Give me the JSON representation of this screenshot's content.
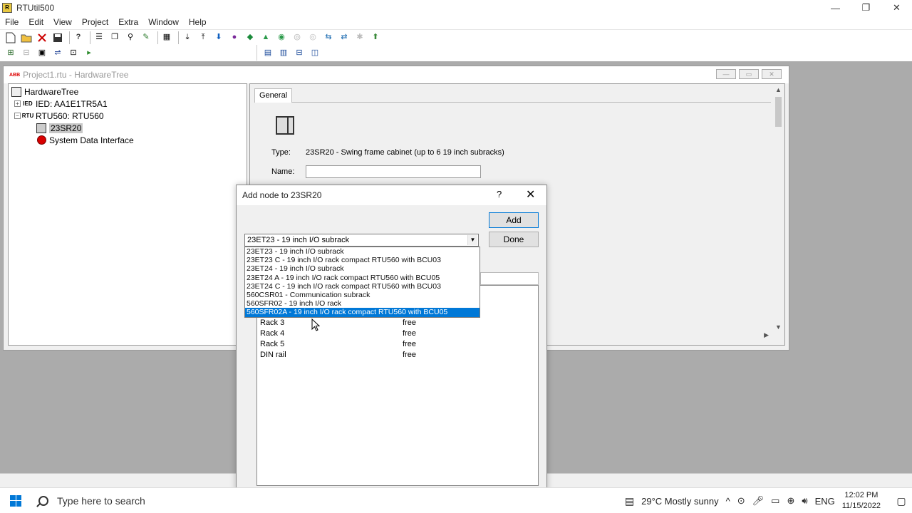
{
  "app": {
    "title": "RTUtil500",
    "icon": "app-icon",
    "controls": [
      "—",
      "❐",
      "✕"
    ]
  },
  "menu": [
    "File",
    "Edit",
    "View",
    "Project",
    "Extra",
    "Window",
    "Help"
  ],
  "child_window": {
    "title": "Project1.rtu - HardwareTree",
    "brand": "ABB"
  },
  "tree": {
    "root": "HardwareTree",
    "items": [
      {
        "label": "IED: AA1E1TR5A1",
        "icon_text": "IED",
        "level": 1
      },
      {
        "label": "RTU560: RTU560",
        "icon_text": "RTU",
        "level": 1
      },
      {
        "label": "23SR20",
        "level": 2,
        "selected": true
      },
      {
        "label": "System Data Interface",
        "level": 2
      }
    ]
  },
  "properties": {
    "tab": "General",
    "type_label": "Type:",
    "type_value": "23SR20 - Swing frame cabinet (up to 6 19 inch subracks)",
    "name_label": "Name:",
    "name_value": ""
  },
  "dialog": {
    "title": "Add node to 23SR20",
    "help": "?",
    "close": "✕",
    "add_button": "Add",
    "done_button": "Done",
    "combo_value": "23ET23 - 19 inch I/O subrack",
    "options": [
      "23ET23 - 19 inch I/O subrack",
      "23ET23 C - 19 inch I/O rack compact RTU560 with BCU03",
      "23ET24 - 19 inch I/O subrack",
      "23ET24 A - 19 inch I/O rack compact RTU560 with BCU05",
      "23ET24 C - 19 inch I/O rack compact RTU560 with BCU03",
      "560CSR01 - Communication subrack",
      "560SFR02 - 19 inch I/O rack",
      "560SFR02A - 19 inch I/O rack compact RTU560 with BCU05"
    ],
    "selected_option_index": 7,
    "racks": [
      {
        "name": "Rack 3",
        "status": "free"
      },
      {
        "name": "Rack 4",
        "status": "free"
      },
      {
        "name": "Rack 5",
        "status": "free"
      },
      {
        "name": "DIN rail",
        "status": "free"
      }
    ]
  },
  "taskbar": {
    "search_placeholder": "Type here to search",
    "weather": "29°C  Mostly sunny",
    "language": "ENG",
    "time": "12:02 PM",
    "date": "11/15/2022"
  },
  "colors": {
    "selection": "#0078d7",
    "mdi_background": "#ababab",
    "tree_error_dot": "#d80000"
  }
}
